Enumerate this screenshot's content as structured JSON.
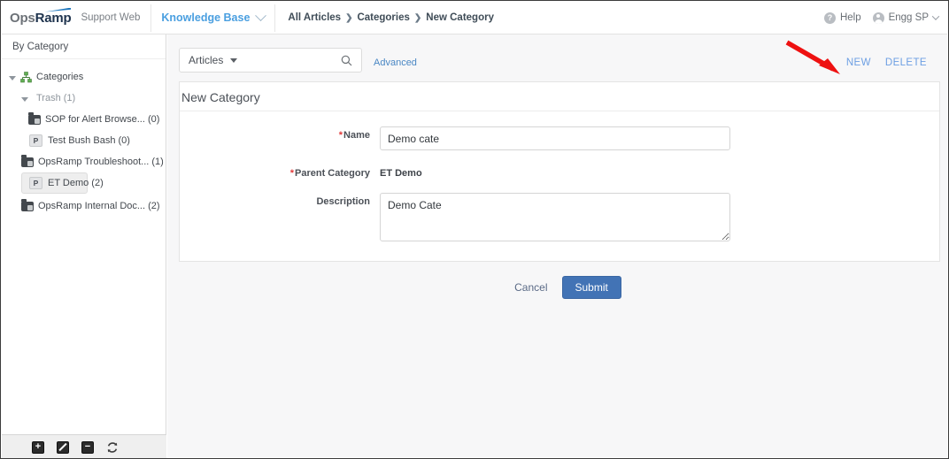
{
  "header": {
    "logo_ops": "Ops",
    "logo_ramp": "Ramp",
    "support_web": "Support Web",
    "product_tab": "Knowledge Base",
    "breadcrumb": [
      "All Articles",
      "Categories",
      "New Category"
    ],
    "breadcrumb_separator": "❯",
    "help_label": "Help",
    "help_icon": "question-circle-icon",
    "user_label": "Engg SP",
    "user_icon": "user-circle-icon"
  },
  "sidebar": {
    "title": "By Category",
    "items": [
      {
        "label": "Categories",
        "icon": "sitemap-icon",
        "indent": 0,
        "twisty": "open",
        "selected": false,
        "muted": false
      },
      {
        "label": "Trash (1)",
        "icon": "none",
        "indent": 1,
        "twisty": "open",
        "selected": false,
        "muted": true
      },
      {
        "label": "SOP for Alert Browse... (0)",
        "icon": "folder-icon",
        "indent": 3,
        "twisty": "none",
        "selected": false,
        "muted": false
      },
      {
        "label": "Test Bush Bash (0)",
        "icon": "page-icon",
        "indent": 3,
        "twisty": "none",
        "selected": false,
        "muted": false
      },
      {
        "label": "OpsRamp Troubleshoot... (1)",
        "icon": "folder-icon",
        "indent": 2,
        "twisty": "none",
        "selected": false,
        "muted": false
      },
      {
        "label": "ET Demo (2)",
        "icon": "page-icon",
        "indent": 2,
        "twisty": "none",
        "selected": true,
        "muted": false
      },
      {
        "label": "OpsRamp Internal Doc... (2)",
        "icon": "folder-icon",
        "indent": 2,
        "twisty": "none",
        "selected": false,
        "muted": false
      }
    ],
    "page_badge_letter": "P",
    "footer_buttons": [
      {
        "name": "add-button",
        "glyph": "+",
        "icon": "plus-square-icon"
      },
      {
        "name": "edit-button",
        "glyph": "",
        "icon": "pencil-square-icon"
      },
      {
        "name": "delete-button",
        "glyph": "−",
        "icon": "minus-square-icon"
      },
      {
        "name": "refresh-button",
        "glyph": "",
        "icon": "refresh-icon"
      }
    ]
  },
  "toolbar": {
    "search_scope": "Articles",
    "search_value": "",
    "search_placeholder": "",
    "search_icon": "search-icon",
    "advanced_label": "Advanced",
    "new_label": "NEW",
    "delete_label": "DELETE"
  },
  "form": {
    "title": "New Category",
    "name_label": "Name",
    "name_value": "Demo cate",
    "name_required": "*",
    "parent_label": "Parent Category",
    "parent_value": "ET Demo",
    "parent_required": "*",
    "description_label": "Description",
    "description_value": "Demo Cate",
    "cancel_label": "Cancel",
    "submit_label": "Submit"
  },
  "annotation": {
    "arrow_color": "#ee1111",
    "arrow_target": "NEW"
  },
  "colors": {
    "accent_blue": "#4a9fe0",
    "link_blue": "#4a87c4",
    "action_blue": "#6d9fe3",
    "submit_blue": "#4273b5",
    "required_red": "#e23b3b",
    "annotation_red": "#ee1111"
  }
}
